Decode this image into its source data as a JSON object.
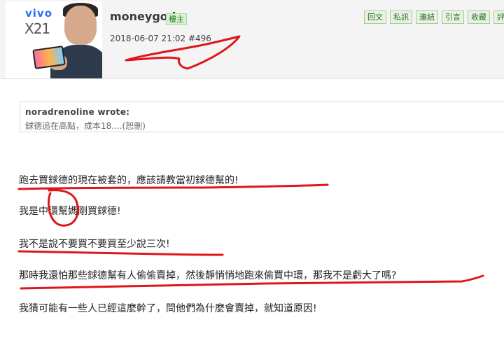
{
  "post": {
    "username": "moneygod",
    "badge": "樓主",
    "timestamp": "2018-06-07 21:02  #496",
    "avatar": {
      "brand": "vivo",
      "model": "X21"
    },
    "actions": [
      "回文",
      "私訊",
      "連結",
      "引言",
      "收藏",
      "評分"
    ]
  },
  "quote": {
    "author": "noradrenoline wrote:",
    "text": "銶德追在高點，成本18....(恕刪)"
  },
  "body": {
    "lines": [
      "跑去買銶德的現在被套的，應該請教當初銶德幫的!",
      "我是中環幫媽剛買銶德!",
      "我不是說不要買不要買至少說三次!",
      "那時我還怕那些銶德幫有人偷偷賣掉，然後靜悄悄地跑來偷買中環，那我不是虧大了嗎?",
      "我猜可能有一些人已經這麼幹了，問他們為什麼會賣掉，就知道原因!"
    ]
  },
  "colors": {
    "annotation": "#e0151b",
    "button_bg": "#e8f3e2",
    "header_bg": "#f4f4f4"
  }
}
